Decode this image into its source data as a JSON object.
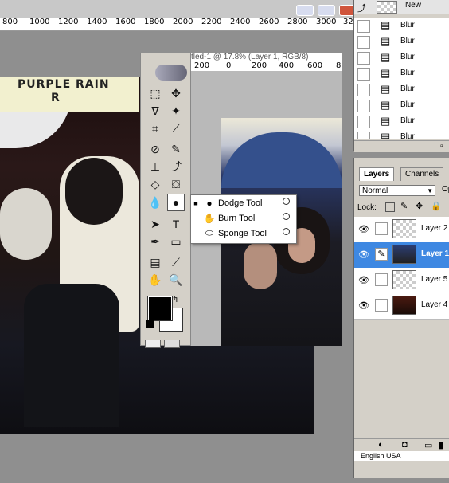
{
  "top_ruler": {
    "ticks": [
      "800",
      "1000",
      "1200",
      "1400",
      "1600",
      "1800",
      "2000",
      "2200",
      "2400",
      "2600",
      "2800",
      "3000",
      "32"
    ]
  },
  "main_image": {
    "marquee_title": "PURPLE RAIN",
    "marquee_sub": "R"
  },
  "doc2": {
    "title": "tled-1 @ 17.8% (Layer 1, RGB/8)",
    "ruler_ticks": [
      "200",
      "0",
      "200",
      "400",
      "600",
      "8"
    ]
  },
  "tool_flyout": {
    "items": [
      {
        "label": "Dodge Tool",
        "icon": "dodge-icon",
        "selected": true
      },
      {
        "label": "Burn Tool",
        "icon": "burn-icon",
        "selected": false
      },
      {
        "label": "Sponge Tool",
        "icon": "sponge-icon",
        "selected": false
      }
    ]
  },
  "history": {
    "top_label": "New",
    "items": [
      "Blur",
      "Blur",
      "Blur",
      "Blur",
      "Blur",
      "Blur",
      "Blur",
      "Blur"
    ]
  },
  "layers": {
    "tabs": [
      "Layers",
      "Channels"
    ],
    "blend_mode": "Normal",
    "opacity_label": "Op",
    "lock_label": "Lock:",
    "rows": [
      {
        "name": "Layer 2",
        "selected": false,
        "thumb": "transparent"
      },
      {
        "name": "Layer 1",
        "selected": true,
        "thumb": "photo"
      },
      {
        "name": "Layer 5",
        "selected": false,
        "thumb": "transparent"
      },
      {
        "name": "Layer 4",
        "selected": false,
        "thumb": "photo-red"
      }
    ],
    "footer_text": "English USA"
  },
  "colors": {
    "foreground": "#000000",
    "background": "#ffffff",
    "selected_layer": "#3e88e2"
  }
}
